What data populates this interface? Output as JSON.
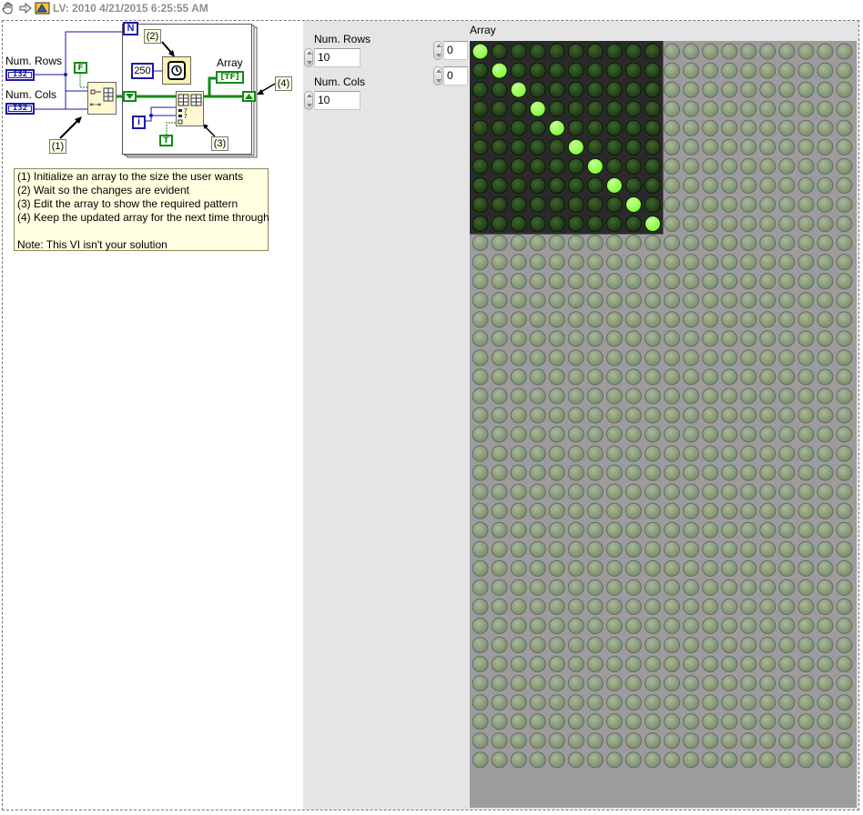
{
  "toolbar": {
    "title": "LV: 2010 4/21/2015 6:25:55 AM",
    "icons": [
      "hand-tool-icon",
      "arrow-icon",
      "vi-icon"
    ]
  },
  "block_diagram": {
    "num_rows_label": "Num. Rows",
    "num_cols_label": "Num. Cols",
    "terminal_type": "I32",
    "bool_false": "F",
    "bool_true": "T",
    "loop_count_terminal": "N",
    "iteration_terminal": "i",
    "wait_constant": "250",
    "array_label": "Array",
    "array_terminal": "[TF]",
    "callout_1": "(1)",
    "callout_2": "(2)",
    "callout_3": "(3)",
    "callout_4": "(4)"
  },
  "notes": [
    "(1) Initialize an array to the size the user wants",
    "(2) Wait so the changes are evident",
    "(3) Edit the array to show the required pattern",
    "(4) Keep the updated array for the next time through",
    "",
    "Note: This VI isn't your solution"
  ],
  "front_panel": {
    "num_rows": {
      "label": "Num. Rows",
      "value": "10"
    },
    "num_cols": {
      "label": "Num. Cols",
      "value": "10"
    },
    "array": {
      "label": "Array",
      "row_index": "0",
      "col_index": "0",
      "visible_rows": 38,
      "visible_cols": 20,
      "active_rows": 10,
      "active_cols": 10,
      "lit_cells": [
        [
          0,
          0
        ],
        [
          1,
          1
        ],
        [
          2,
          2
        ],
        [
          3,
          3
        ],
        [
          4,
          4
        ],
        [
          5,
          5
        ],
        [
          6,
          6
        ],
        [
          7,
          7
        ],
        [
          8,
          8
        ],
        [
          9,
          9
        ]
      ],
      "colors": {
        "led_on": "#7cff2e",
        "led_off": "#1c3810",
        "led_disabled": "#7a8f6a",
        "active_bg": "#2a2a2a",
        "inactive_bg": "#a8a8a8"
      }
    }
  }
}
